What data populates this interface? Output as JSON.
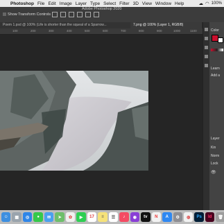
{
  "menubar": {
    "app_name": "Photoshop",
    "menus": [
      "File",
      "Edit",
      "Image",
      "Layer",
      "Type",
      "Select",
      "Filter",
      "3D",
      "View",
      "Window",
      "Help"
    ],
    "window_title": "Adobe Photoshop 2020",
    "battery": "100%"
  },
  "options_bar": {
    "show_transform_label": "Show Transform Controls"
  },
  "document_tabs": [
    {
      "label": "Poem 1.psd @ 100% (Life is shorter than the squeal of a  Sparrow..."
    },
    {
      "label": "7.png @ 100% (Layer 1, RGB/8)"
    }
  ],
  "ruler": {
    "ticks": [
      "100",
      "200",
      "300",
      "400",
      "500",
      "600",
      "700",
      "800",
      "900",
      "1000",
      "1100"
    ]
  },
  "right_panel": {
    "color_tab": "Color",
    "learn_label": "Learn",
    "add_label": "Add a",
    "layers_tab": "Layer",
    "kind_label": "Kin",
    "normal_label": "Norm",
    "lock_label": "Lock"
  },
  "dock": {
    "calendar_day": "17",
    "apps": [
      "finder",
      "launchpad",
      "safari",
      "messages",
      "mail",
      "maps",
      "photos",
      "facetime",
      "calendar",
      "notes",
      "reminders",
      "music",
      "podcasts",
      "tv",
      "news",
      "app-store",
      "system-preferences",
      "chrome",
      "photoshop",
      "indesign",
      "trash"
    ],
    "photoshop_label": "Ps",
    "indesign_label": "Id",
    "tv_label": "tv"
  },
  "colors": {
    "foreground_swatch": "#c8102e",
    "background_swatch": "#ffffff",
    "photoshop_icon": "#001e36",
    "indesign_icon": "#49021f"
  }
}
